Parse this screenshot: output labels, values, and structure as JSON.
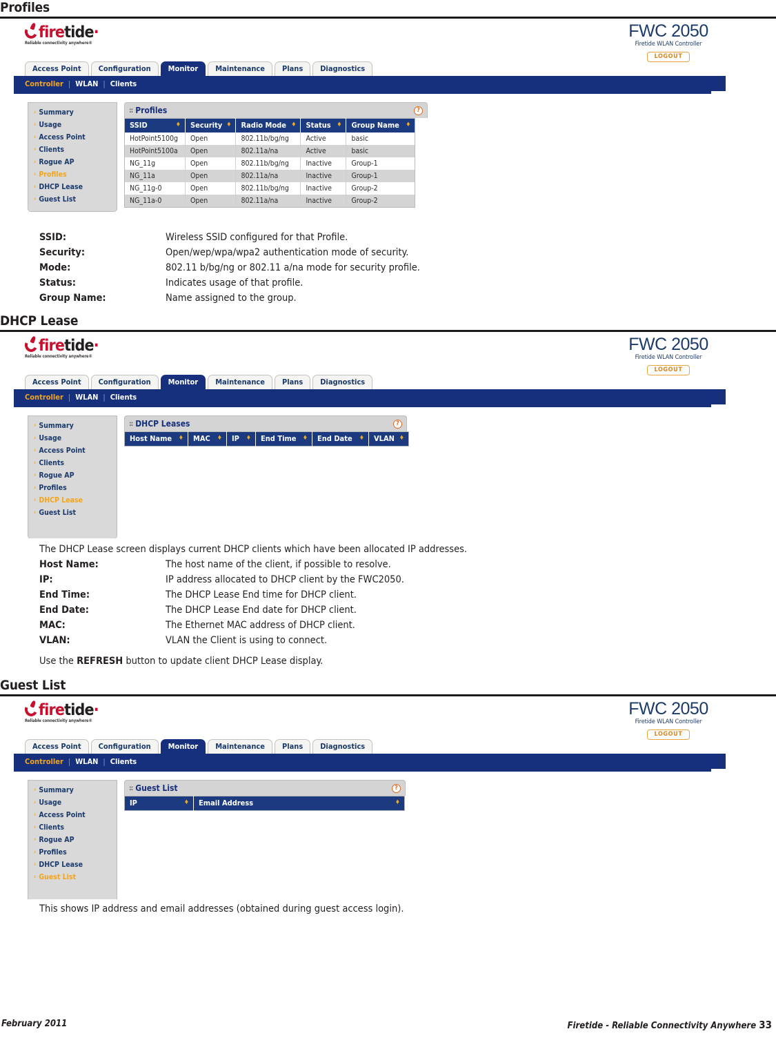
{
  "sections": {
    "profiles": {
      "heading": "Profiles"
    },
    "dhcp": {
      "heading": "DHCP Lease"
    },
    "guest": {
      "heading": "Guest List"
    }
  },
  "app": {
    "logo": {
      "fire": "fire",
      "tide": "tide",
      "dot": "·",
      "tagline": "Reliable connectivity anywhere®"
    },
    "product": {
      "model": "FWC 2050",
      "subtitle": "Firetide WLAN Controller",
      "logout_label": "LOGOUT"
    },
    "tabs": [
      {
        "label": "Access Point",
        "active": false
      },
      {
        "label": "Configuration",
        "active": false
      },
      {
        "label": "Monitor",
        "active": true
      },
      {
        "label": "Maintenance",
        "active": false
      },
      {
        "label": "Plans",
        "active": false
      },
      {
        "label": "Diagnostics",
        "active": false
      }
    ],
    "breadcrumb": {
      "first": "Controller",
      "second": "WLAN",
      "third": "Clients",
      "separator": "|"
    },
    "sidebar_items": [
      "Summary",
      "Usage",
      "Access Point",
      "Clients",
      "Rogue AP",
      "Profiles",
      "DHCP Lease",
      "Guest List"
    ],
    "icons": {
      "grip": "::",
      "help": "?",
      "nav_arrow": "›",
      "sort": "♦"
    }
  },
  "screens": {
    "profiles": {
      "active_nav": "Profiles",
      "panel_title": "Profiles",
      "columns": [
        "SSID",
        "Security",
        "Radio Mode",
        "Status",
        "Group Name"
      ],
      "rows": [
        [
          "HotPoint5100g",
          "Open",
          "802.11b/bg/ng",
          "Active",
          "basic"
        ],
        [
          "HotPoint5100a",
          "Open",
          "802.11a/na",
          "Active",
          "basic"
        ],
        [
          "NG_11g",
          "Open",
          "802.11b/bg/ng",
          "Inactive",
          "Group-1"
        ],
        [
          "NG_11a",
          "Open",
          "802.11a/na",
          "Inactive",
          "Group-1"
        ],
        [
          "NG_11g-0",
          "Open",
          "802.11b/bg/ng",
          "Inactive",
          "Group-2"
        ],
        [
          "NG_11a-0",
          "Open",
          "802.11a/na",
          "Inactive",
          "Group-2"
        ]
      ]
    },
    "dhcp": {
      "active_nav": "DHCP Lease",
      "panel_title": "DHCP Leases",
      "columns": [
        "Host Name",
        "MAC",
        "IP",
        "End Time",
        "End Date",
        "VLAN"
      ],
      "rows": []
    },
    "guest": {
      "active_nav": "Guest List",
      "panel_title": "Guest List",
      "columns": [
        "IP",
        "Email Address"
      ],
      "rows": []
    }
  },
  "definitions": {
    "profiles": [
      {
        "term": "SSID:",
        "desc": "Wireless SSID configured for that Profile."
      },
      {
        "term": "Security:",
        "desc": "Open/wep/wpa/wpa2 authentication mode of security."
      },
      {
        "term": "Mode:",
        "desc": "802.11 b/bg/ng or 802.11 a/na mode for security profile."
      },
      {
        "term": "Status:",
        "desc": "Indicates usage of that profile."
      },
      {
        "term": "Group Name:",
        "desc": "Name assigned to the group."
      }
    ],
    "dhcp_intro": "The DHCP Lease screen displays current DHCP clients which have been allocated IP addresses.",
    "dhcp": [
      {
        "term": "Host Name:",
        "desc": "The host name of the client, if possible to resolve."
      },
      {
        "term": "IP:",
        "desc": "IP address allocated to DHCP client by the FWC2050."
      },
      {
        "term": "End Time:",
        "desc": "The DHCP Lease End time for DHCP client."
      },
      {
        "term": "End Date:",
        "desc": "The DHCP Lease End date for DHCP client."
      },
      {
        "term": "MAC:",
        "desc": "The Ethernet MAC address of DHCP client."
      },
      {
        "term": "VLAN:",
        "desc": "VLAN the Client is using to connect."
      }
    ],
    "refresh_note": {
      "pre": "Use the ",
      "bold": "REFRESH",
      "post": " button to update client DHCP Lease display."
    },
    "guest_note": "This shows IP address and email addresses (obtained during guest access login)."
  },
  "footer": {
    "left": "February 2011",
    "right": "Firetide - Reliable Connectivity Anywhere",
    "page": "33"
  },
  "colors": {
    "nav_blue": "#17307e",
    "header_blue": "#1b3a80",
    "accent_orange": "#f2a51c",
    "brand_red": "#c8102e",
    "panel_gray": "#d4d4d4"
  }
}
